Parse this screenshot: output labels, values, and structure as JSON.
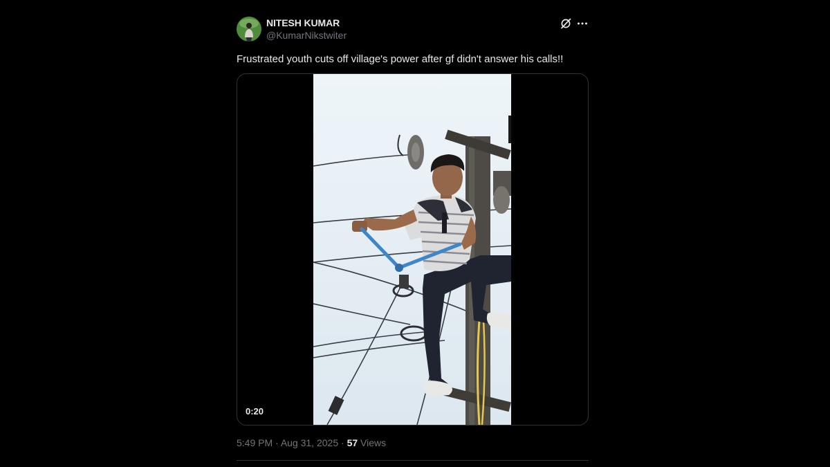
{
  "author": {
    "display_name": "NITESH KUMAR",
    "handle": "@KumarNikstwiter"
  },
  "icons": {
    "grok": "grok-icon",
    "more": "more-icon",
    "avatar": "avatar"
  },
  "tweet": {
    "text": "Frustrated youth cuts off village's power after gf didn't answer his calls!!"
  },
  "media": {
    "duration": "0:20"
  },
  "meta": {
    "time": "5:49 PM",
    "separator": " · ",
    "date": "Aug 31, 2025",
    "views_count": "57",
    "views_label": " Views"
  },
  "colors": {
    "background": "#000000",
    "text_primary": "#e7e9ea",
    "text_secondary": "#71767b",
    "border": "#2f3336",
    "sky": "#e6eff5"
  }
}
